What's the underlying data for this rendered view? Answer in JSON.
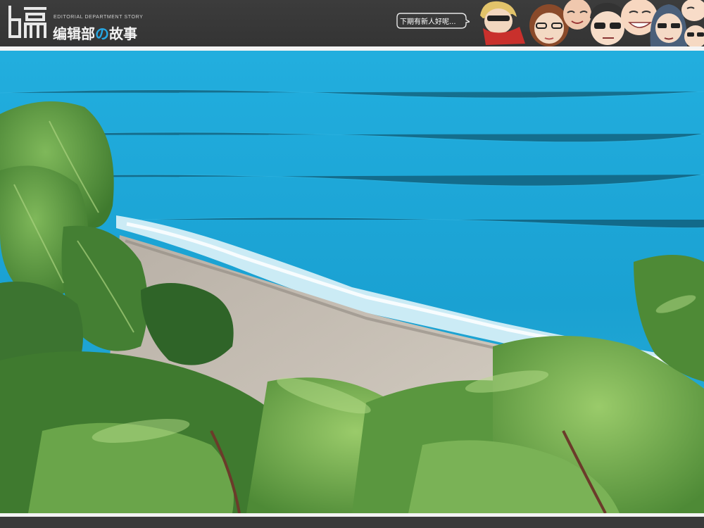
{
  "header": {
    "logo_sub": "EDITORIAL DEPARTMENT STORY",
    "logo_title_part1": "编辑部",
    "logo_title_accent": "の",
    "logo_title_part2": "故事",
    "bubble_text": "下期有新人好呢..."
  },
  "icons": {
    "logo": "editorial-logo-icon",
    "bubble": "speech-bubble-icon",
    "characters": "character-faces-icon"
  },
  "colors": {
    "header_bg": "#3a3a3a",
    "accent": "#26a9e6",
    "divider": "#f4f4f4",
    "sea": "#1aa3cf",
    "sand": "#c9c2b7",
    "leaf": "#6aa54a"
  }
}
